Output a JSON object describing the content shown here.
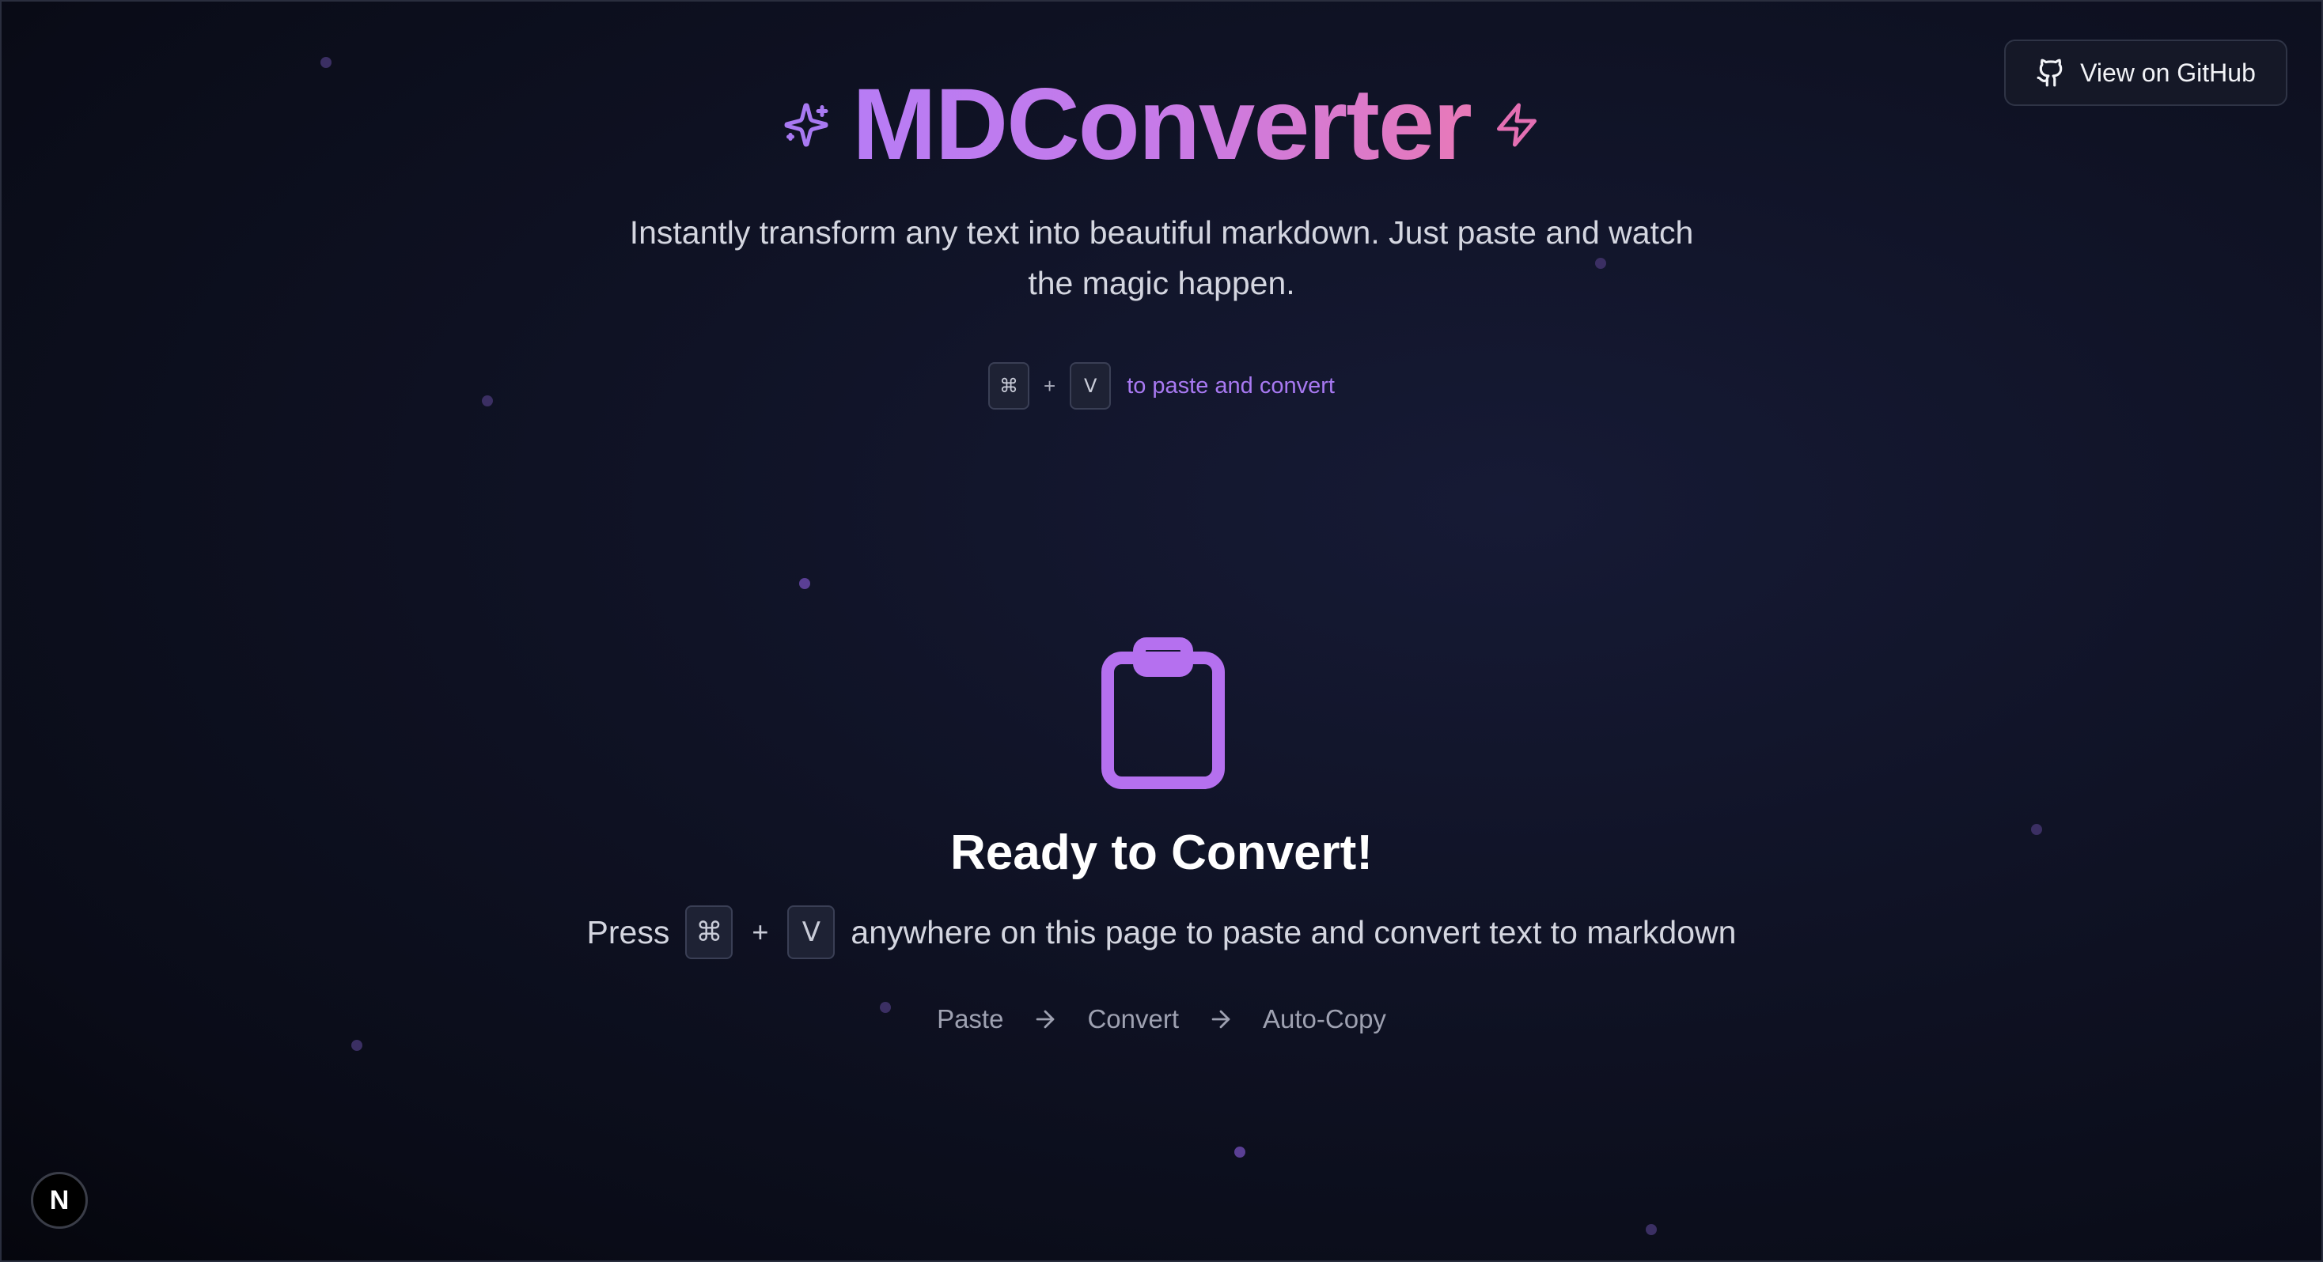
{
  "header": {
    "title": "MDConverter",
    "subtitle": "Instantly transform any text into beautiful markdown. Just paste and watch the magic happen.",
    "left_icon": "sparkles-icon",
    "right_icon": "zap-icon"
  },
  "github_button": {
    "label": "View on GitHub",
    "icon": "github-icon"
  },
  "shortcut_hint": {
    "key_modifier": "⌘",
    "plus": "+",
    "key_letter": "V",
    "text": "to paste and convert"
  },
  "main": {
    "icon": "clipboard-icon",
    "heading": "Ready to Convert!",
    "press_prefix": "Press",
    "key_modifier": "⌘",
    "plus": "+",
    "key_letter": "V",
    "press_suffix": "anywhere on this page to paste and convert text to markdown"
  },
  "steps": [
    {
      "label": "Paste"
    },
    {
      "label": "Convert"
    },
    {
      "label": "Auto-Copy"
    }
  ],
  "badge": {
    "label": "N"
  },
  "colors": {
    "accent_purple": "#a879f2",
    "title_gradient_start": "#b77cf5",
    "title_gradient_end": "#e879b8",
    "background": "#0f1224"
  }
}
